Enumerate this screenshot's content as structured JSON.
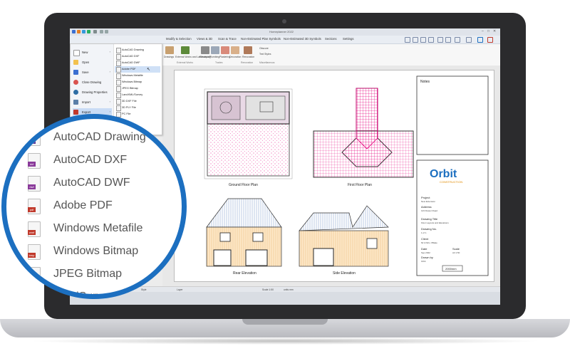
{
  "app": {
    "title": "Homeplanner 2022"
  },
  "tabs": [
    "Modify & Selection",
    "Views & 3D",
    "Scan & Trace",
    "Non-Estimated Plan Symbols",
    "Non-Estimated 3D Symbols",
    "Sections",
    "Settings"
  ],
  "ribbon": {
    "buttons": [
      "Drawings",
      "External Works and Landscaping",
      "Electrical",
      "Plumbing",
      "Plastering",
      "Decoration",
      "Renovation"
    ],
    "small": [
      "Obscure",
      "Text Styles"
    ],
    "groups": [
      "External Works",
      "Trades",
      "Renovation",
      "Miscellaneous"
    ]
  },
  "menu": {
    "items": [
      "New",
      "Open",
      "Save",
      "Close Drawing",
      "Drawing Properties",
      "Import",
      "Export",
      "Print"
    ],
    "selected": "Export",
    "submenu": [
      "AutoCAD Drawing",
      "AutoCAD DXF",
      "AutoCAD DWF",
      "Adobe PDF",
      "Windows Metafile",
      "Windows Bitmap",
      "JPEG Bitmap",
      "LandXML/Survey",
      "3D DXF File",
      "3D PLY File",
      "PC File"
    ],
    "submenu_selected": "Adobe PDF"
  },
  "drawing": {
    "labels": [
      "Ground Floor Plan",
      "First Floor Plan",
      "Rear Elevation",
      "Side Elevation"
    ],
    "notes_title": "Notes",
    "logo": "Orbit",
    "logo_sub": "CONSTRUCTION",
    "titleblock": [
      {
        "k": "Project",
        "v": "New Extension"
      },
      {
        "k": "Address",
        "v": "123 Flower Road"
      },
      {
        "k": "Drawing Title",
        "v": "Floor Layouts and Elevations"
      },
      {
        "k": "Drawing No.",
        "v": "1 of 1"
      },
      {
        "k": "Client",
        "v": "Mr & Mrs J Blake"
      },
      {
        "k": "Date",
        "v": "Sep 2022"
      },
      {
        "k": "Scale",
        "v": "A3 1:50"
      },
      {
        "k": "Drawn by",
        "v": "Orbit"
      }
    ],
    "scale_bar": "2000mm"
  },
  "status": {
    "style": "Style",
    "layer": "Layer",
    "coords": "Scale 1:50",
    "units": "units mm"
  },
  "magnifier": {
    "items": [
      {
        "label": "AutoCAD Drawing",
        "badge": "",
        "color": "#5b3a9a"
      },
      {
        "label": "AutoCAD DXF",
        "badge": "dxf",
        "color": "#8a3a9a"
      },
      {
        "label": "AutoCAD DWF",
        "badge": "dwf",
        "color": "#8a3a9a"
      },
      {
        "label": "Adobe PDF",
        "badge": "pdf",
        "color": "#c0392b"
      },
      {
        "label": "Windows Metafile",
        "badge": "wmf",
        "color": "#c0392b"
      },
      {
        "label": "Windows Bitmap",
        "badge": "bmp",
        "color": "#c0392b"
      },
      {
        "label": "JPEG Bitmap",
        "badge": "jpg",
        "color": "#c0392b"
      },
      {
        "label": "LandSurvey",
        "badge": "",
        "color": "#c0392b"
      }
    ]
  },
  "colors": {
    "accent": "#1c6fc0",
    "laptop": "#2b2b2d",
    "plan_pink": "#e6007e"
  }
}
